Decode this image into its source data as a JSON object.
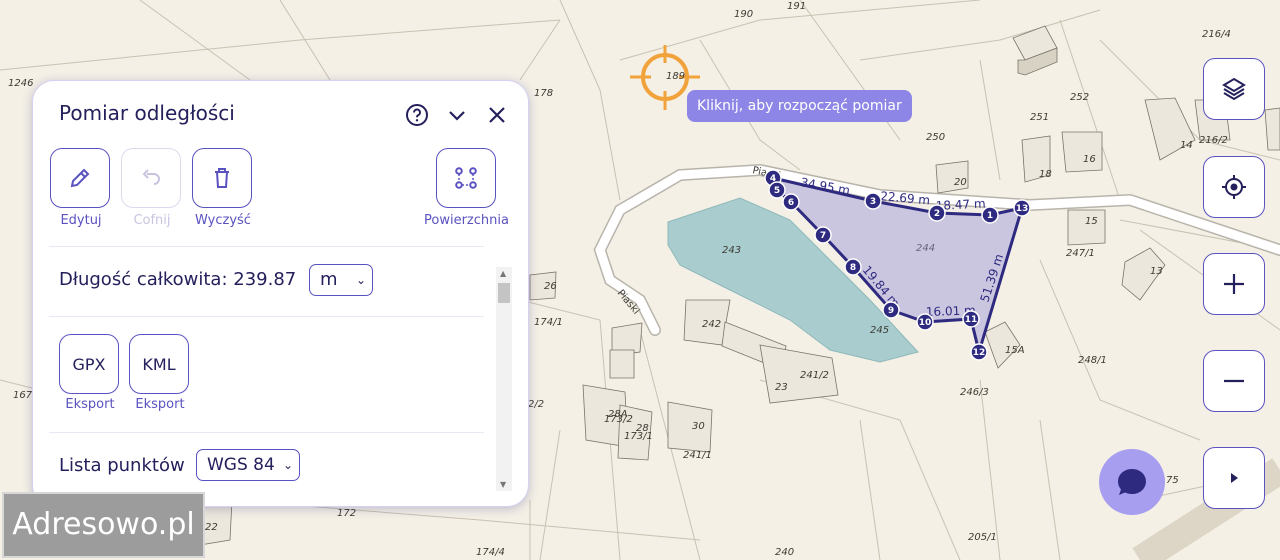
{
  "map": {
    "parcel_labels": [
      "190",
      "191",
      "1246",
      "178",
      "189",
      "250",
      "252",
      "251",
      "216/4",
      "216/2",
      "20",
      "18",
      "16",
      "14",
      "15",
      "247/1",
      "13",
      "243",
      "244",
      "245",
      "26",
      "174/1",
      "242",
      "241/2",
      "23",
      "15A",
      "248/1",
      "246/3",
      "167",
      "2/2",
      "28A",
      "173/2",
      "28",
      "173/1",
      "30",
      "241/1",
      "75",
      "172",
      "174/4",
      "240",
      "205/1",
      "22"
    ],
    "street_labels": [
      "Piaski",
      "Piaski"
    ],
    "segment_labels": [
      "34.95 m",
      "22.69 m",
      "18.47 m",
      "19.84 m",
      "16.01 m",
      "51.39 m"
    ],
    "points": [
      "1",
      "2",
      "3",
      "4",
      "5",
      "6",
      "7",
      "8",
      "9",
      "10",
      "11",
      "12",
      "13"
    ],
    "crosshair_label": "189",
    "colors": {
      "route": "#2e2a80",
      "polygon": "#9a93d6",
      "crosshair": "#f2a23a",
      "water": "#a9cdcf"
    }
  },
  "hint": "Kliknij, aby rozpocząć pomiar",
  "panel": {
    "title": "Pomiar odległości",
    "icons": [
      "help-icon",
      "chevron-down-icon",
      "close-icon"
    ],
    "tools": {
      "edit": "Edytuj",
      "undo": "Cofnij",
      "clear": "Wyczyść",
      "area": "Powierzchnia"
    },
    "total_label": "Długość całkowita: 239.87",
    "unit": "m",
    "exports": [
      {
        "format": "GPX",
        "label": "Eksport"
      },
      {
        "format": "KML",
        "label": "Eksport"
      }
    ],
    "points_list_label": "Lista punktów",
    "crs": "WGS 84"
  },
  "controls": [
    "layers-icon",
    "locate-icon",
    "zoom-in-icon",
    "zoom-out-icon",
    "expand-icon"
  ],
  "logo": "Adresowo.pl"
}
